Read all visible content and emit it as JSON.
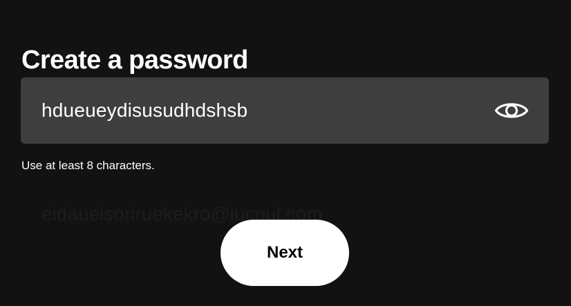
{
  "page": {
    "title": "Create a password"
  },
  "password_field": {
    "value": "hdueueydisusudhdshsb",
    "toggle_icon": "eye-icon"
  },
  "helper": {
    "text": "Use at least 8 characters."
  },
  "background_hint": {
    "text": "eidaueisoriruekekro@iucoul.com"
  },
  "actions": {
    "next_label": "Next"
  },
  "colors": {
    "background": "#121212",
    "field_background": "#3e3e3e",
    "text": "#ffffff",
    "button_background": "#ffffff",
    "button_text": "#000000"
  }
}
